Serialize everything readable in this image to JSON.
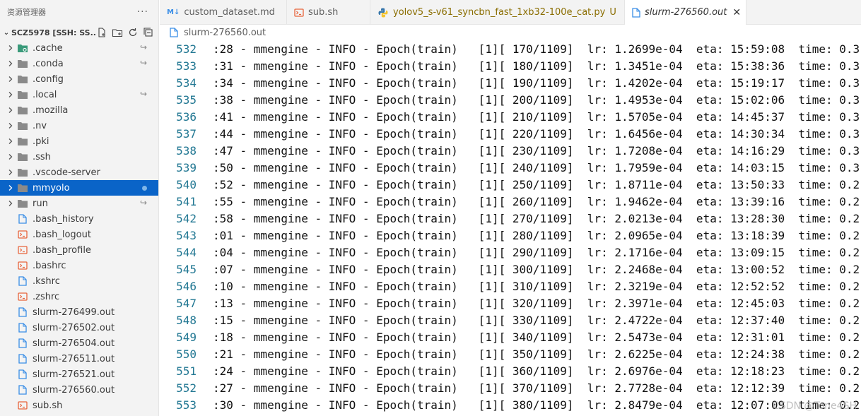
{
  "sidebar": {
    "title": "资源管理器",
    "more": "···",
    "root": "SCZ5978 [SSH: SS...",
    "items": [
      {
        "label": ".cache",
        "kind": "folder",
        "icon": "cache-folder-icon",
        "badge": "↪"
      },
      {
        "label": ".conda",
        "kind": "folder",
        "icon": "folder-icon",
        "badge": "↪"
      },
      {
        "label": ".config",
        "kind": "folder",
        "icon": "folder-icon",
        "badge": ""
      },
      {
        "label": ".local",
        "kind": "folder",
        "icon": "folder-icon",
        "badge": "↪"
      },
      {
        "label": ".mozilla",
        "kind": "folder",
        "icon": "folder-icon",
        "badge": ""
      },
      {
        "label": ".nv",
        "kind": "folder",
        "icon": "folder-icon",
        "badge": ""
      },
      {
        "label": ".pki",
        "kind": "folder",
        "icon": "folder-icon",
        "badge": ""
      },
      {
        "label": ".ssh",
        "kind": "folder",
        "icon": "folder-icon",
        "badge": ""
      },
      {
        "label": ".vscode-server",
        "kind": "folder",
        "icon": "folder-icon",
        "badge": ""
      },
      {
        "label": "mmyolo",
        "kind": "folder",
        "icon": "folder-icon",
        "badge": "",
        "selected": true,
        "dot": true
      },
      {
        "label": "run",
        "kind": "folder",
        "icon": "folder-icon",
        "badge": "↪"
      },
      {
        "label": ".bash_history",
        "kind": "file",
        "icon": "file-icon"
      },
      {
        "label": ".bash_logout",
        "kind": "file",
        "icon": "shell-icon"
      },
      {
        "label": ".bash_profile",
        "kind": "file",
        "icon": "shell-icon"
      },
      {
        "label": ".bashrc",
        "kind": "file",
        "icon": "shell-icon"
      },
      {
        "label": ".kshrc",
        "kind": "file",
        "icon": "file-icon"
      },
      {
        "label": ".zshrc",
        "kind": "file",
        "icon": "shell-icon"
      },
      {
        "label": "slurm-276499.out",
        "kind": "file",
        "icon": "file-icon"
      },
      {
        "label": "slurm-276502.out",
        "kind": "file",
        "icon": "file-icon"
      },
      {
        "label": "slurm-276504.out",
        "kind": "file",
        "icon": "file-icon"
      },
      {
        "label": "slurm-276511.out",
        "kind": "file",
        "icon": "file-icon"
      },
      {
        "label": "slurm-276521.out",
        "kind": "file",
        "icon": "file-icon"
      },
      {
        "label": "slurm-276560.out",
        "kind": "file",
        "icon": "file-icon"
      },
      {
        "label": "sub.sh",
        "kind": "file",
        "icon": "shell-icon"
      }
    ]
  },
  "tabs": [
    {
      "label": "custom_dataset.md",
      "icon": "markdown-icon",
      "icon_text": "M↓"
    },
    {
      "label": "sub.sh",
      "icon": "shell-icon"
    },
    {
      "label": "yolov5_s-v61_syncbn_fast_1xb32-100e_cat.py",
      "icon": "python-icon",
      "modified": "U"
    },
    {
      "label": "slurm-276560.out",
      "icon": "file-icon",
      "active": true,
      "close": "✕"
    }
  ],
  "breadcrumb": {
    "label": "slurm-276560.out"
  },
  "editor": {
    "lines": [
      {
        "n": "532",
        "text": ":28 - mmengine - INFO - Epoch(train)   [1][ 170/1109]  lr: 1.2699e-04  eta: 15:59:08  time: 0.3"
      },
      {
        "n": "533",
        "text": ":31 - mmengine - INFO - Epoch(train)   [1][ 180/1109]  lr: 1.3451e-04  eta: 15:38:36  time: 0.3"
      },
      {
        "n": "534",
        "text": ":34 - mmengine - INFO - Epoch(train)   [1][ 190/1109]  lr: 1.4202e-04  eta: 15:19:17  time: 0.3"
      },
      {
        "n": "535",
        "text": ":38 - mmengine - INFO - Epoch(train)   [1][ 200/1109]  lr: 1.4953e-04  eta: 15:02:06  time: 0.3"
      },
      {
        "n": "536",
        "text": ":41 - mmengine - INFO - Epoch(train)   [1][ 210/1109]  lr: 1.5705e-04  eta: 14:45:37  time: 0.3"
      },
      {
        "n": "537",
        "text": ":44 - mmengine - INFO - Epoch(train)   [1][ 220/1109]  lr: 1.6456e-04  eta: 14:30:34  time: 0.3"
      },
      {
        "n": "538",
        "text": ":47 - mmengine - INFO - Epoch(train)   [1][ 230/1109]  lr: 1.7208e-04  eta: 14:16:29  time: 0.3"
      },
      {
        "n": "539",
        "text": ":50 - mmengine - INFO - Epoch(train)   [1][ 240/1109]  lr: 1.7959e-04  eta: 14:03:15  time: 0.3"
      },
      {
        "n": "540",
        "text": ":52 - mmengine - INFO - Epoch(train)   [1][ 250/1109]  lr: 1.8711e-04  eta: 13:50:33  time: 0.2"
      },
      {
        "n": "541",
        "text": ":55 - mmengine - INFO - Epoch(train)   [1][ 260/1109]  lr: 1.9462e-04  eta: 13:39:16  time: 0.2"
      },
      {
        "n": "542",
        "text": ":58 - mmengine - INFO - Epoch(train)   [1][ 270/1109]  lr: 2.0213e-04  eta: 13:28:30  time: 0.2"
      },
      {
        "n": "543",
        "text": ":01 - mmengine - INFO - Epoch(train)   [1][ 280/1109]  lr: 2.0965e-04  eta: 13:18:39  time: 0.2"
      },
      {
        "n": "544",
        "text": ":04 - mmengine - INFO - Epoch(train)   [1][ 290/1109]  lr: 2.1716e-04  eta: 13:09:15  time: 0.2"
      },
      {
        "n": "545",
        "text": ":07 - mmengine - INFO - Epoch(train)   [1][ 300/1109]  lr: 2.2468e-04  eta: 13:00:52  time: 0.2"
      },
      {
        "n": "546",
        "text": ":10 - mmengine - INFO - Epoch(train)   [1][ 310/1109]  lr: 2.3219e-04  eta: 12:52:52  time: 0.2"
      },
      {
        "n": "547",
        "text": ":13 - mmengine - INFO - Epoch(train)   [1][ 320/1109]  lr: 2.3971e-04  eta: 12:45:03  time: 0.2"
      },
      {
        "n": "548",
        "text": ":15 - mmengine - INFO - Epoch(train)   [1][ 330/1109]  lr: 2.4722e-04  eta: 12:37:40  time: 0.2"
      },
      {
        "n": "549",
        "text": ":18 - mmengine - INFO - Epoch(train)   [1][ 340/1109]  lr: 2.5473e-04  eta: 12:31:01  time: 0.2"
      },
      {
        "n": "550",
        "text": ":21 - mmengine - INFO - Epoch(train)   [1][ 350/1109]  lr: 2.6225e-04  eta: 12:24:38  time: 0.2"
      },
      {
        "n": "551",
        "text": ":24 - mmengine - INFO - Epoch(train)   [1][ 360/1109]  lr: 2.6976e-04  eta: 12:18:23  time: 0.2"
      },
      {
        "n": "552",
        "text": ":27 - mmengine - INFO - Epoch(train)   [1][ 370/1109]  lr: 2.7728e-04  eta: 12:12:39  time: 0.2"
      },
      {
        "n": "553",
        "text": ":30 - mmengine - INFO - Epoch(train)   [1][ 380/1109]  lr: 2.8479e-04  eta: 12:07:09  time: 0.2"
      }
    ]
  },
  "watermark": "CSDN @Tone4SH",
  "colors": {
    "selected": "#0a64c8",
    "line_number": "#237893",
    "folder": "#8a8a8a",
    "shell": "#e8643c",
    "file": "#3a8ee6",
    "python": "#3776ab"
  }
}
